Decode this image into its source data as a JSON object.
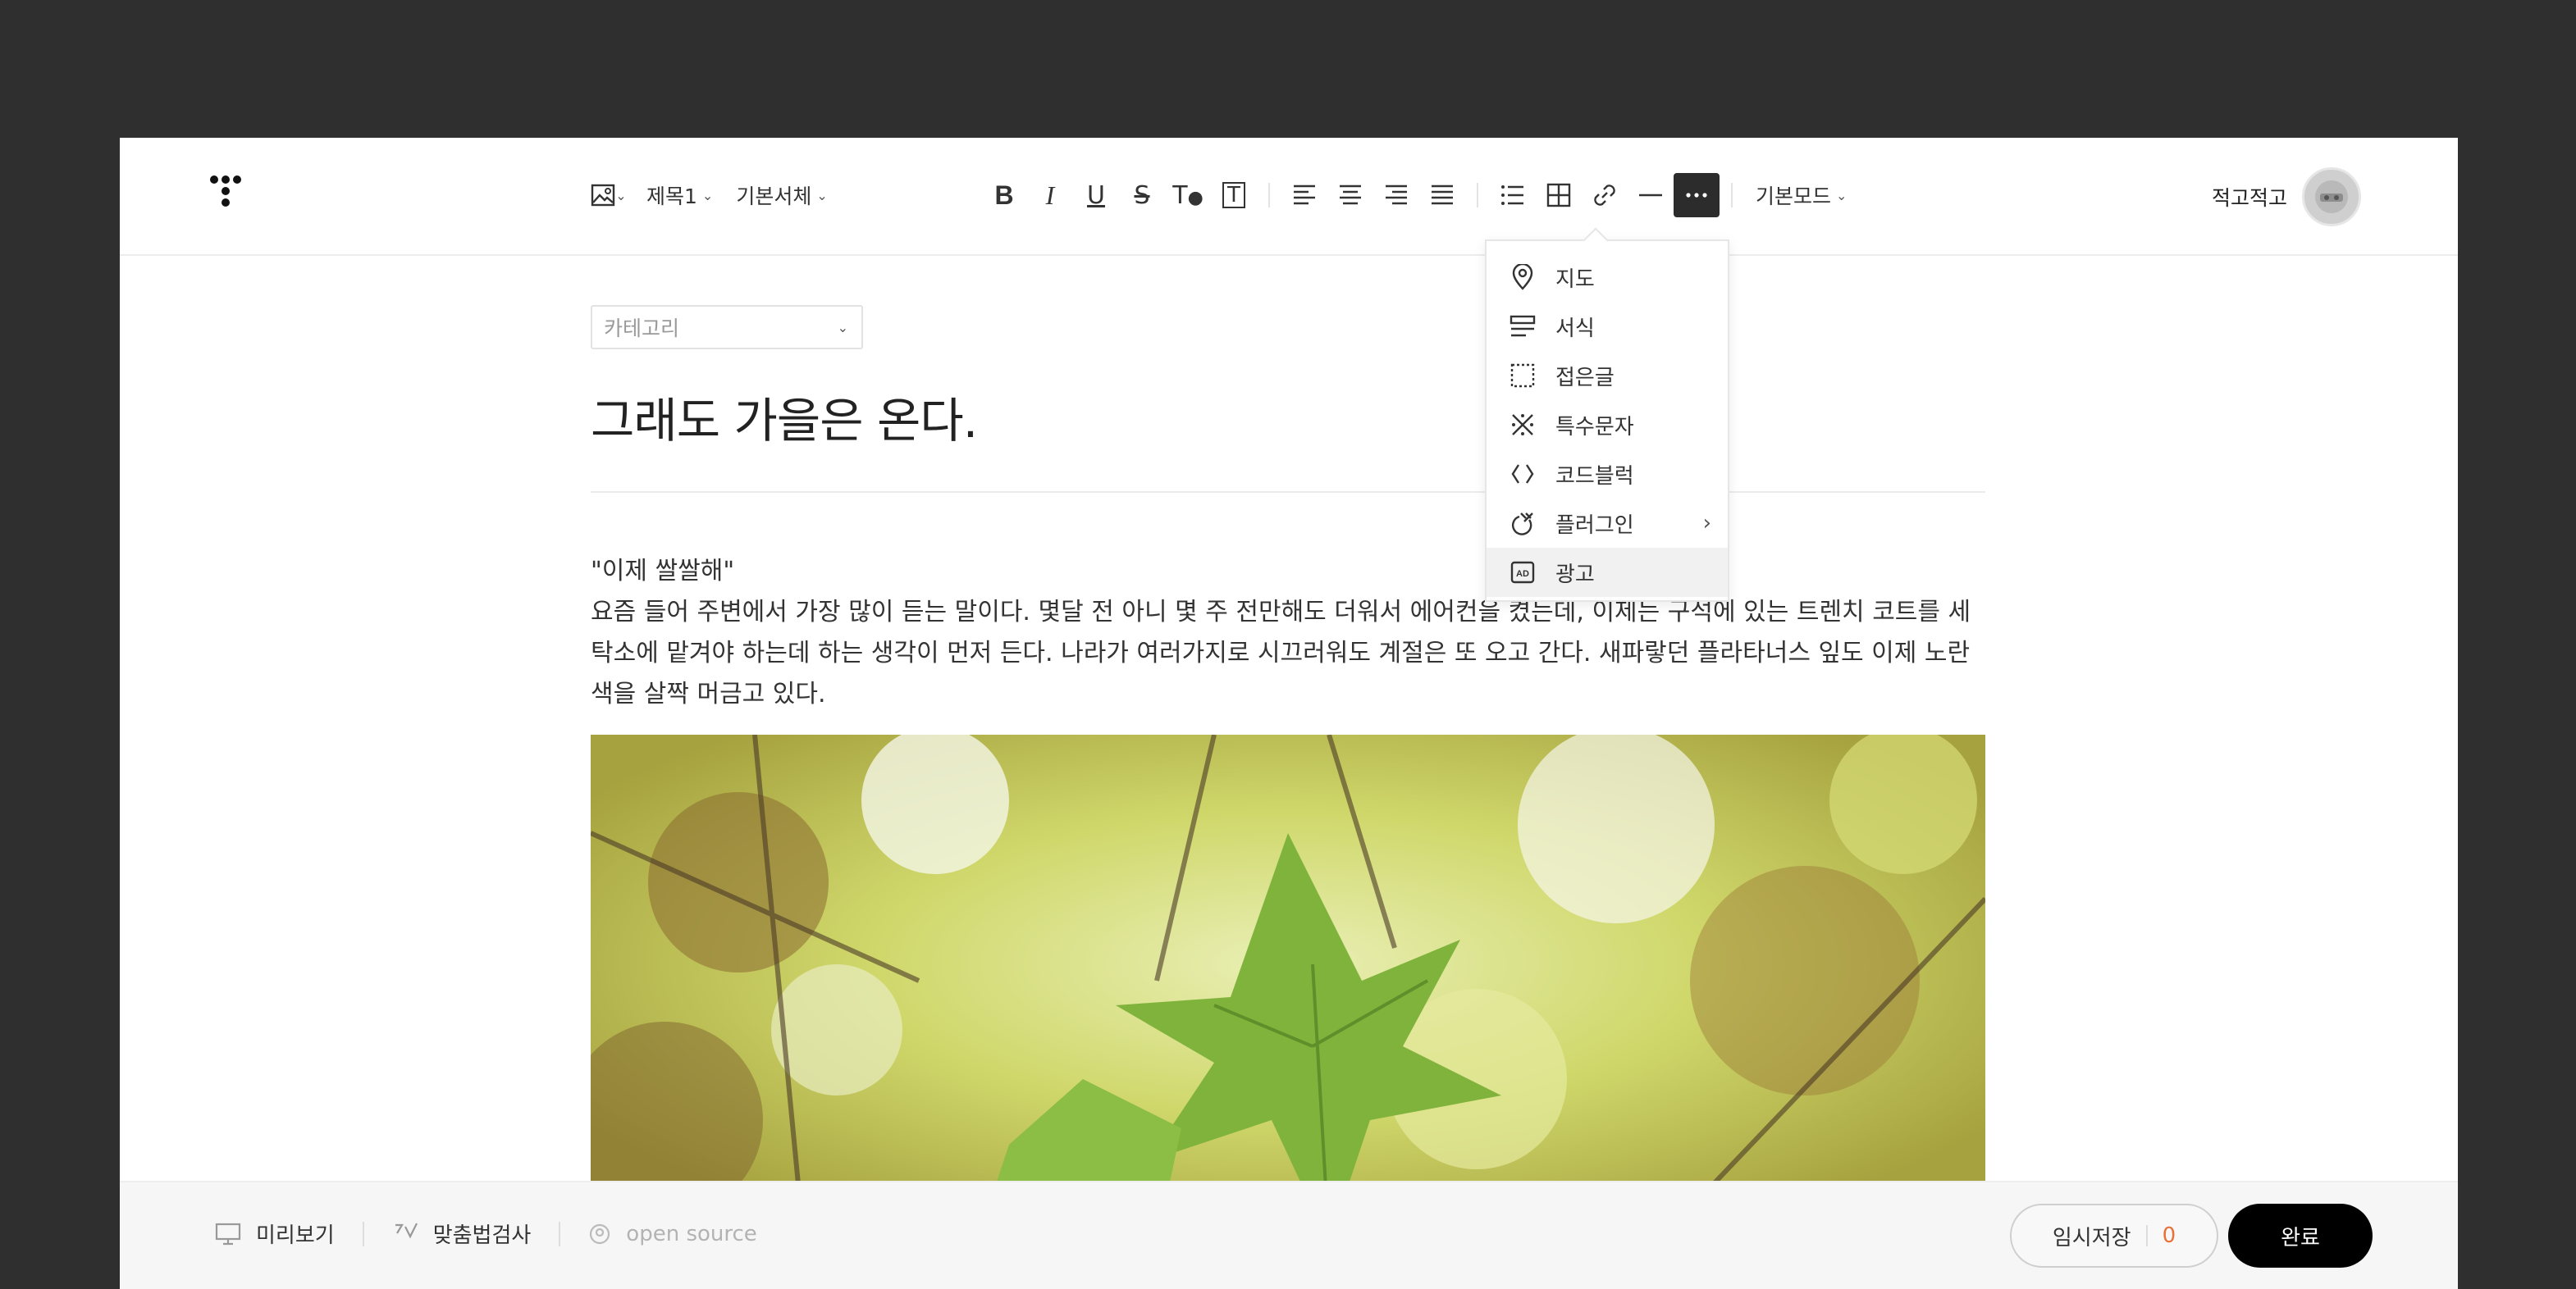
{
  "toolbar": {
    "image_label": "image",
    "heading_select": "제목1",
    "font_select": "기본서체",
    "mode_select": "기본모드",
    "icons": [
      "image-icon",
      "bold-icon",
      "italic-icon",
      "underline-icon",
      "strikethrough-icon",
      "text-color-icon",
      "text-background-icon",
      "align-left-icon",
      "align-center-icon",
      "align-right-icon",
      "align-justify-icon",
      "list-icon",
      "table-icon",
      "link-icon",
      "horizontal-rule-icon",
      "more-icon"
    ]
  },
  "user": {
    "name": "적고적고"
  },
  "post": {
    "category_placeholder": "카테고리",
    "title": "그래도 가을은 온다.",
    "paragraphs": [
      "\"이제 쌀쌀해\"",
      "요즘 들어 주변에서 가장 많이 듣는 말이다. 몇달 전 아니 몇 주 전만해도 더워서 에어컨을 켰는데, 이제는 구석에 있는 트렌치 코트를 세탁소에 맡겨야 하는데 하는 생각이 먼저 든다. 나라가 여러가지로 시끄러워도 계절은 또 오고 간다. 새파랗던 플라타너스 잎도 이제 노란색을 살짝 머금고 있다."
    ]
  },
  "more_menu": {
    "items": [
      {
        "label": "지도",
        "icon": "map-pin-icon"
      },
      {
        "label": "서식",
        "icon": "template-icon"
      },
      {
        "label": "접은글",
        "icon": "fold-text-icon"
      },
      {
        "label": "특수문자",
        "icon": "special-char-icon"
      },
      {
        "label": "코드블럭",
        "icon": "code-block-icon"
      },
      {
        "label": "플러그인",
        "icon": "plugin-icon"
      },
      {
        "label": "광고",
        "icon": "ad-icon"
      }
    ],
    "selected": "광고"
  },
  "bottom": {
    "preview": "미리보기",
    "spellcheck": "맞춤법검사",
    "open_source": "open source",
    "save": "임시저장",
    "save_count": "0",
    "done": "완료"
  },
  "colors": {
    "accent": "#e8713a",
    "dark": "#2c2c2c",
    "background": "#2f2f2f"
  }
}
